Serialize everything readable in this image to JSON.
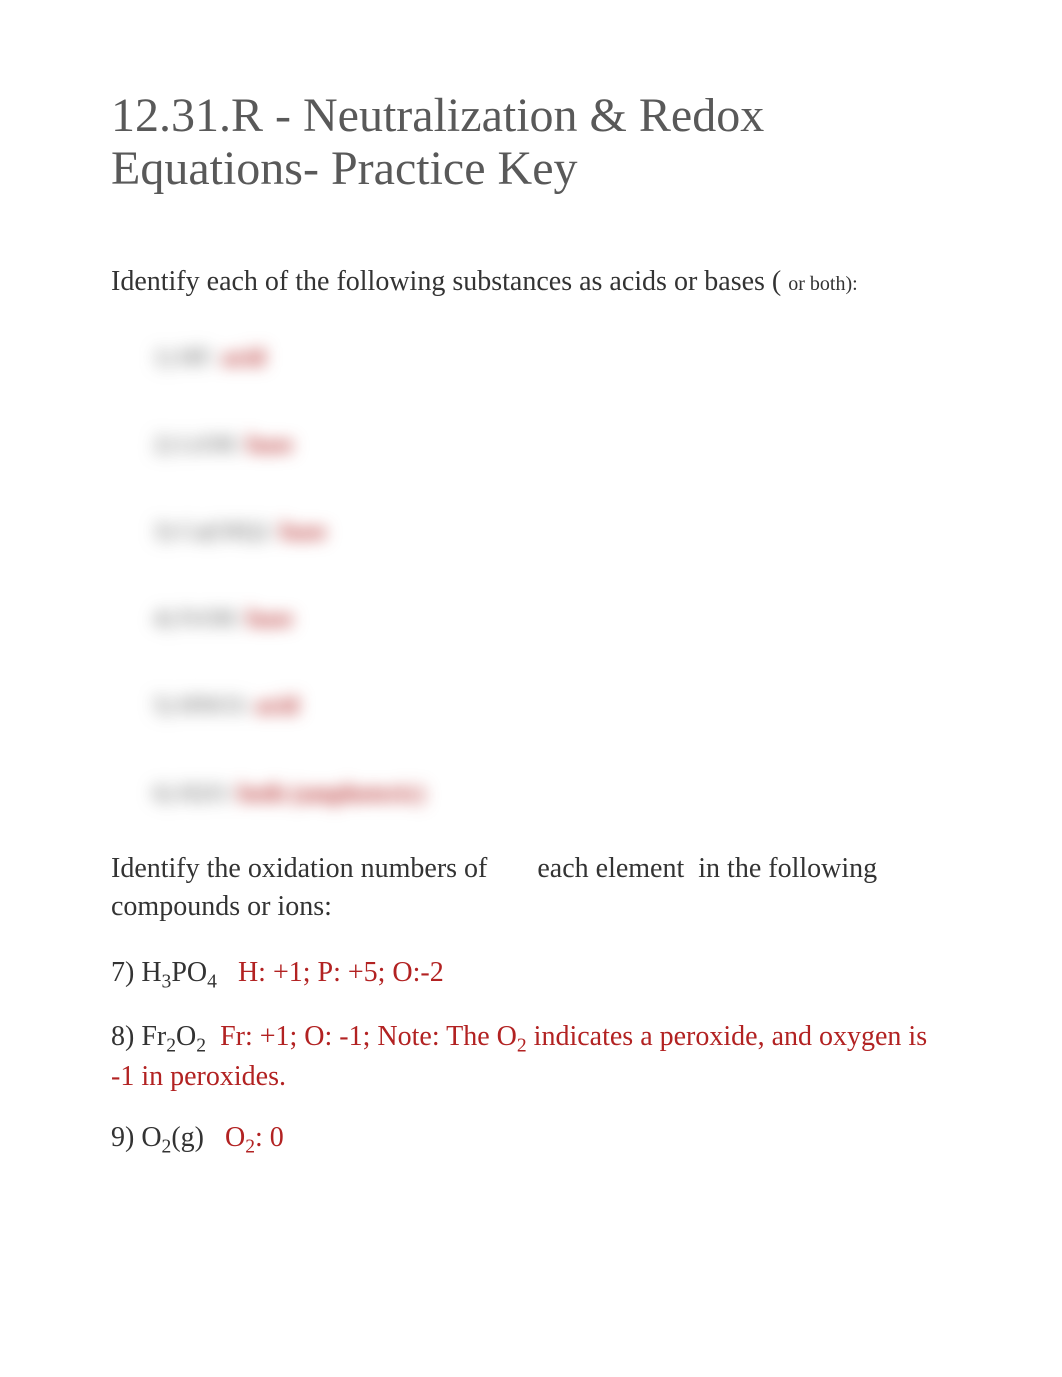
{
  "title": "12.31.R - Neutralization & Redox Equations- Practice Key",
  "prompt1": {
    "lead": "Identify each of the following substances as acids or bases (",
    "tail": "or both):"
  },
  "list": [
    {
      "label": "1) HF:",
      "answer": "acid"
    },
    {
      "label": "2) LiOH:",
      "answer": "base"
    },
    {
      "label": "3) Ca(OH)2:",
      "answer": "base"
    },
    {
      "label": "4) FrOH:",
      "answer": "base"
    },
    {
      "label": "5) HNO3:",
      "answer": "acid"
    },
    {
      "label": "6) H2O:",
      "answer": "both (amphoteric)"
    }
  ],
  "prompt2": {
    "a": "Identify the oxidation numbers of",
    "b": "each element",
    "c": "in the following compounds or ions:"
  },
  "q7": {
    "label_a": "7) H",
    "label_sub1": "3",
    "label_b": "PO",
    "label_sub2": "4",
    "answer": "H: +1; P: +5; O:-2"
  },
  "q8": {
    "label_a": "8) Fr",
    "label_sub1": "2",
    "label_b": "O",
    "label_sub2": "2",
    "ans_a": "Fr: +1; O: -1;   Note: The O",
    "ans_sub": "2",
    "ans_b": " indicates a peroxide, and oxygen is -1 in peroxides."
  },
  "q9": {
    "label_a": "9) O",
    "label_sub": "2",
    "label_b": "(g)",
    "ans_a": "O",
    "ans_sub": "2",
    "ans_b": ": 0"
  }
}
